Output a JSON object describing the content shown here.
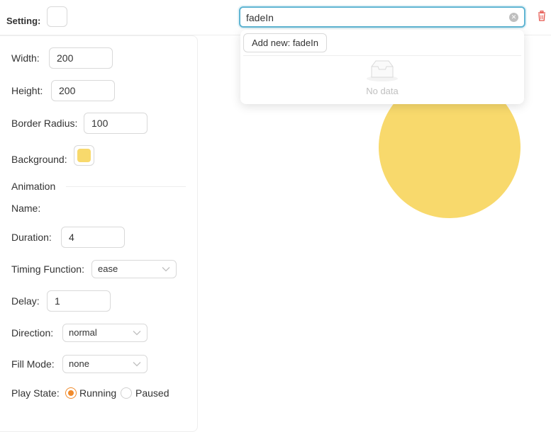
{
  "header": {
    "setting_label": "Setting:",
    "animation_search": {
      "value": "fadeIn",
      "placeholder": ""
    }
  },
  "dropdown": {
    "add_new_label": "Add new: fadeIn",
    "empty_text": "No data"
  },
  "form": {
    "width": {
      "label": "Width:",
      "value": "200"
    },
    "height": {
      "label": "Height:",
      "value": "200"
    },
    "border_radius": {
      "label": "Border Radius:",
      "value": "100"
    },
    "background": {
      "label": "Background:",
      "color": "#f8d96c"
    },
    "animation_section": "Animation",
    "name": {
      "label": "Name:"
    },
    "duration": {
      "label": "Duration:",
      "value": "4"
    },
    "timing_function": {
      "label": "Timing Function:",
      "value": "ease"
    },
    "delay": {
      "label": "Delay:",
      "value": "1"
    },
    "direction": {
      "label": "Direction:",
      "value": "normal"
    },
    "fill_mode": {
      "label": "Fill Mode:",
      "value": "none"
    },
    "play_state": {
      "label": "Play State:",
      "options": [
        "Running",
        "Paused"
      ],
      "selected": "Running"
    }
  },
  "colors": {
    "accent": "#f08a2b",
    "focus_border": "#5fb5d3",
    "delete": "#e5534b",
    "preview_shape": "#f8d96c"
  },
  "icons": {
    "clear": "clear-circle-icon",
    "delete": "trash-icon",
    "empty": "empty-inbox-icon",
    "select_arrow": "chevron-down-icon"
  }
}
